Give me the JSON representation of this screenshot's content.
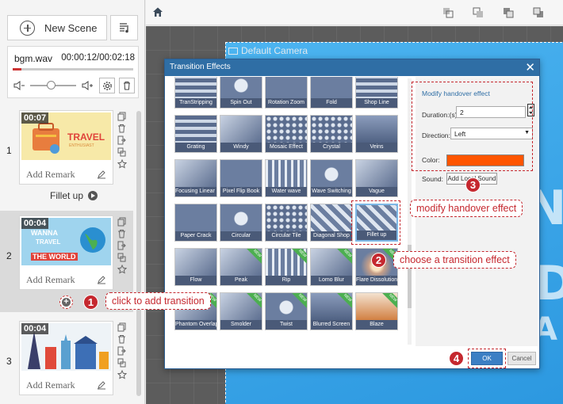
{
  "sidebar": {
    "new_scene_label": "New Scene",
    "bgm": {
      "name": "bgm.wav",
      "time": "00:00:12/00:02:18",
      "progress_fraction": 0.07,
      "volume_fraction": 0.45
    },
    "scenes": [
      {
        "number": "1",
        "time": "00:07",
        "remark": "Add Remark",
        "thumb_text": [
          "TRAVEL",
          "ENTHUSIAST"
        ]
      },
      {
        "number": "2",
        "time": "00:04",
        "remark": "Add Remark",
        "thumb_text": [
          "WANNA",
          "TRAVEL",
          "THE WORLD"
        ]
      },
      {
        "number": "3",
        "time": "00:04",
        "remark": "Add Remark",
        "thumb_text": []
      }
    ],
    "transition_name": "Fillet up"
  },
  "canvas": {
    "camera_label": "Default Camera"
  },
  "dialog": {
    "title": "Transition Effects",
    "close_glyph": "✕",
    "effects": [
      {
        "label": "TranStripping",
        "new": false
      },
      {
        "label": "Spin Out",
        "new": false
      },
      {
        "label": "Rotation Zoom",
        "new": false
      },
      {
        "label": "Fold",
        "new": false
      },
      {
        "label": "Shop Line",
        "new": false
      },
      {
        "label": "Grating",
        "new": false
      },
      {
        "label": "Windy",
        "new": false
      },
      {
        "label": "Mosaic Effect",
        "new": false
      },
      {
        "label": "Crystal",
        "new": false
      },
      {
        "label": "Veins",
        "new": false
      },
      {
        "label": "Focusing Linear Blur",
        "new": false
      },
      {
        "label": "Pixel Flip Book",
        "new": false
      },
      {
        "label": "Water wave",
        "new": false
      },
      {
        "label": "Wave Switching",
        "new": false
      },
      {
        "label": "Vague",
        "new": false
      },
      {
        "label": "Paper Crack",
        "new": false
      },
      {
        "label": "Circular",
        "new": false
      },
      {
        "label": "Circular Tile",
        "new": false
      },
      {
        "label": "Diagonal Shop",
        "new": false
      },
      {
        "label": "Fillet up",
        "new": false,
        "selected": true
      },
      {
        "label": "Flow",
        "new": false
      },
      {
        "label": "Peak",
        "new": true
      },
      {
        "label": "Rip",
        "new": true
      },
      {
        "label": "Lomo Blur",
        "new": true
      },
      {
        "label": "Flare Dissolution",
        "new": true
      },
      {
        "label": "Phantom Overlap",
        "new": true
      },
      {
        "label": "Smolder",
        "new": true
      },
      {
        "label": "Twist",
        "new": true
      },
      {
        "label": "Blurred Screen",
        "new": true
      },
      {
        "label": "Blaze",
        "new": true
      }
    ],
    "props": {
      "title": "Modify handover effect",
      "duration_label": "Duration:(s)",
      "duration_value": "2",
      "direction_label": "Direction:",
      "direction_value": "Left",
      "color_label": "Color:",
      "color_value": "#ff5500",
      "sound_label": "Sound:",
      "sound_button": "Add Local Sound"
    },
    "ok_label": "OK",
    "cancel_label": "Cancel"
  },
  "callouts": {
    "c1": {
      "num": "1",
      "text": "click to add transition"
    },
    "c2": {
      "num": "2",
      "text": "choose a transition effect"
    },
    "c3": {
      "num": "3",
      "text": "modify handover effect"
    },
    "c4": {
      "num": "4"
    }
  },
  "colors": {
    "accent": "#c5282f",
    "dialog_title": "#2f6ea5",
    "ok_button": "#3b7fc4"
  }
}
